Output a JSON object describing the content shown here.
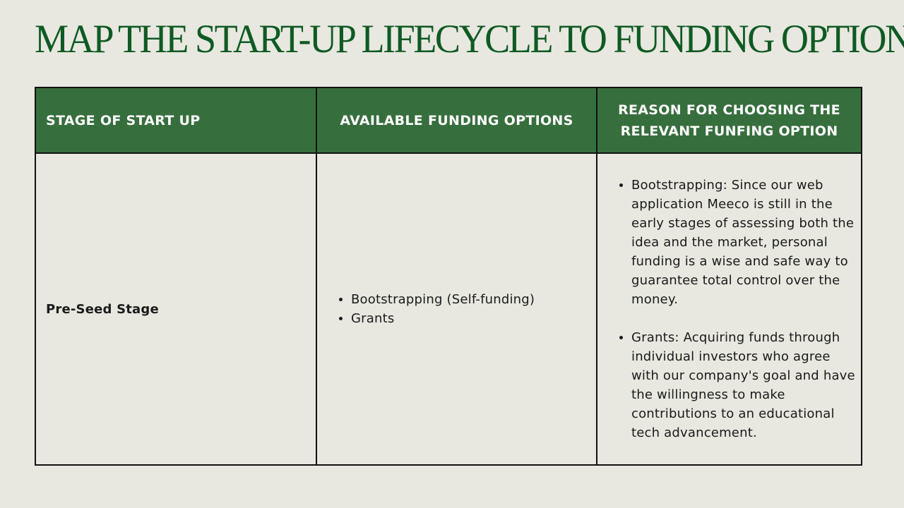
{
  "page": {
    "title": "MAP THE START-UP LIFECYCLE TO FUNDING OPTIONS"
  },
  "table": {
    "headers": [
      "STAGE OF START UP",
      "AVAILABLE FUNDING OPTIONS",
      "REASON FOR CHOOSING THE RELEVANT FUNFING OPTION"
    ],
    "rows": [
      {
        "stage": "Pre-Seed Stage",
        "options": [
          "Bootstrapping (Self-funding)",
          "Grants"
        ],
        "reasons": [
          "Bootstrapping: Since our web application Meeco is still in the early stages of assessing both the idea and the market, personal funding is a wise and safe way to guarantee total control over the money.",
          "Grants: Acquiring funds through individual investors who agree with our company's goal and have the willingness to make contributions to an educational tech advancement."
        ]
      }
    ]
  },
  "colors": {
    "background": "#e8e8e0",
    "title": "#0f5a24",
    "header_fill": "#376e3d",
    "header_text": "#ffffff",
    "border": "#111111"
  }
}
